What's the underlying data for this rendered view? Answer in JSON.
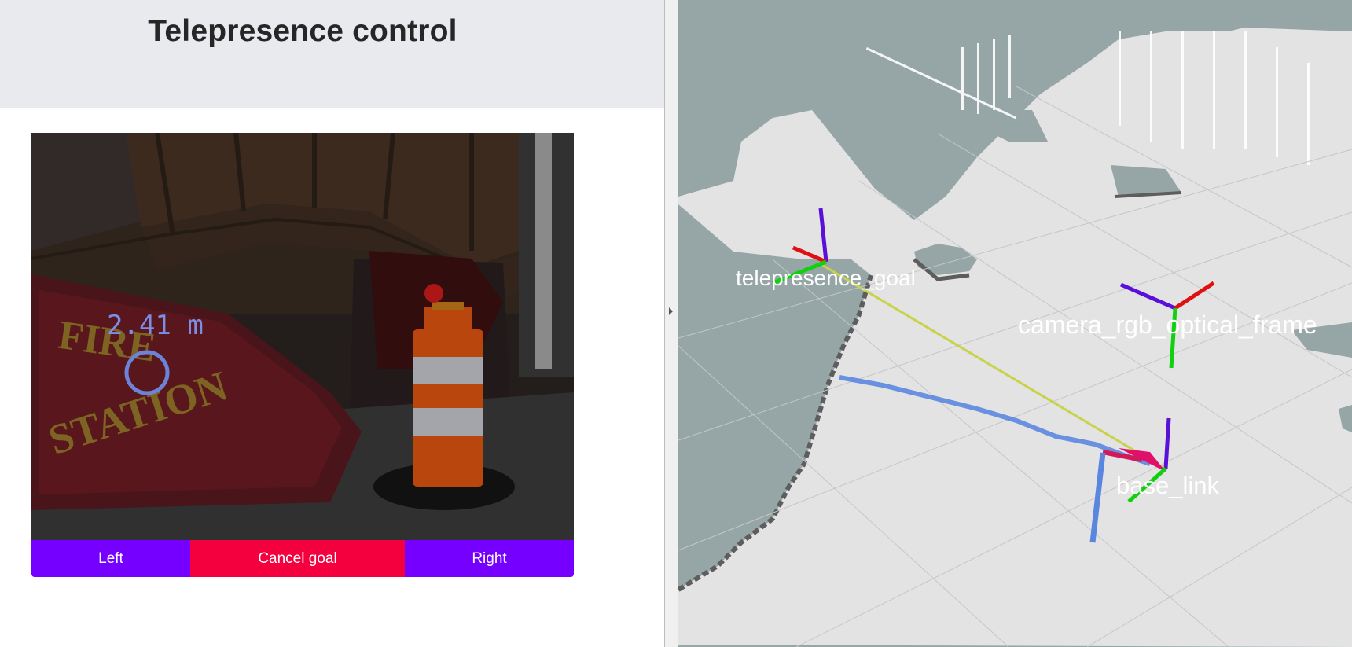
{
  "header": {
    "title": "Telepresence control"
  },
  "camera": {
    "distance_label": "2.41 m",
    "sign_text": "FIRE STATION"
  },
  "controls": {
    "left_label": "Left",
    "cancel_label": "Cancel goal",
    "right_label": "Right"
  },
  "visualization": {
    "frames": {
      "goal": "telepresence_goal",
      "camera": "camera_rgb_optical_frame",
      "base": "base_link"
    },
    "colors": {
      "map_unknown": "#96a6a6",
      "map_free": "#e3e3e3",
      "path": "#5b86e0",
      "goal_line": "#c8d24a",
      "axis_x": "#e01010",
      "axis_y": "#10d010",
      "axis_z": "#5a10d8"
    }
  },
  "splitter": {
    "icon": "chevron-right-icon"
  }
}
